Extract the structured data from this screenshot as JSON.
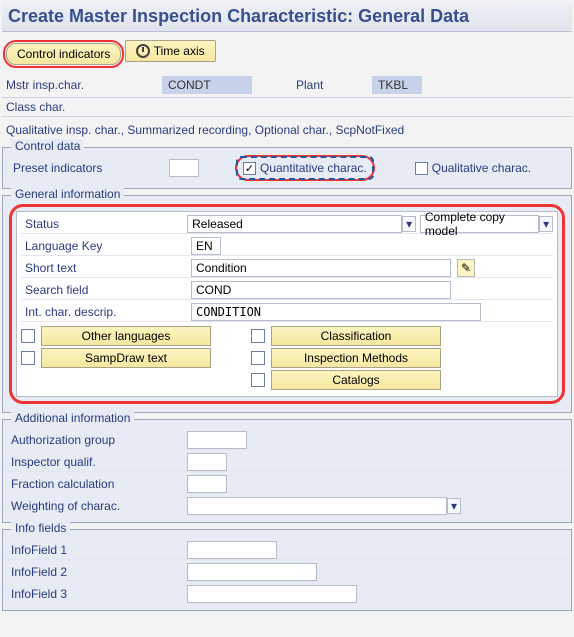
{
  "page_title": "Create Master Inspection Characteristic: General Data",
  "toolbar": {
    "control_indicators": "Control indicators",
    "time_axis": "Time axis"
  },
  "header": {
    "mstr_insp_label": "Mstr insp.char.",
    "mstr_insp_value": "CONDT",
    "plant_label": "Plant",
    "plant_value": "TKBL",
    "class_char_label": "Class char.",
    "class_char_value": ""
  },
  "desc_line": "Qualitative insp. char., Summarized recording, Optional char., ScpNotFixed",
  "control_data": {
    "group": "Control data",
    "preset_label": "Preset indicators",
    "preset_value": "",
    "quant_label": "Quantitative charac.",
    "qual_label": "Qualitative charac."
  },
  "general": {
    "group": "General information",
    "status_label": "Status",
    "status_value": "Released",
    "copy_model": "Complete copy model",
    "lang_label": "Language Key",
    "lang_value": "EN",
    "short_label": "Short text",
    "short_value": "Condition",
    "search_label": "Search field",
    "search_value": "COND",
    "int_label": "Int. char. descrip.",
    "int_value": "CONDITION",
    "buttons": {
      "other_languages": "Other languages",
      "sampdraw": "SampDraw text",
      "classification": "Classification",
      "inspection_methods": "Inspection Methods",
      "catalogs": "Catalogs"
    }
  },
  "additional": {
    "group": "Additional information",
    "auth_label": "Authorization group",
    "auth_value": "",
    "insp_label": "Inspector qualif.",
    "insp_value": "",
    "frac_label": "Fraction calculation",
    "frac_value": "",
    "weight_label": "Weighting of charac.",
    "weight_value": ""
  },
  "info": {
    "group": "Info fields",
    "f1_label": "InfoField 1",
    "f1_value": "",
    "f2_label": "InfoField 2",
    "f2_value": "",
    "f3_label": "InfoField 3",
    "f3_value": ""
  }
}
